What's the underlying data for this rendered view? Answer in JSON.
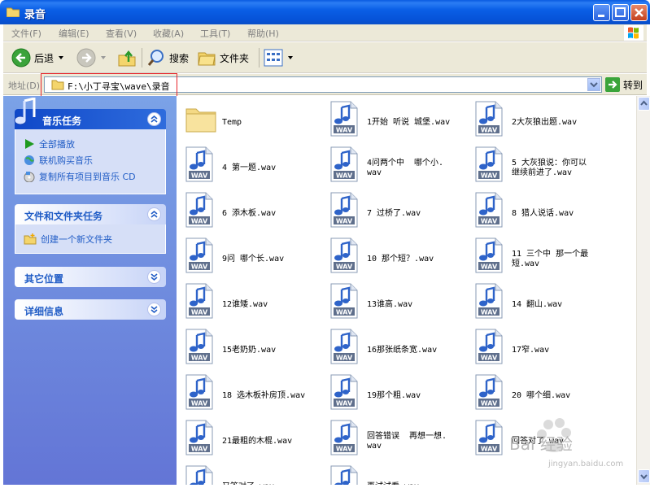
{
  "window": {
    "title": "录音",
    "colors": {
      "titlebar": "#0a5fe6",
      "leftpane": "#6f8cdf",
      "link": "#215dc6",
      "highlight": "#e8262b"
    }
  },
  "menu": [
    "文件(F)",
    "编辑(E)",
    "查看(V)",
    "收藏(A)",
    "工具(T)",
    "帮助(H)"
  ],
  "toolbar": {
    "back_label": "后退",
    "search_label": "搜索",
    "folders_label": "文件夹"
  },
  "address": {
    "label": "地址(D)",
    "value": "F:\\小丁寻宝\\wave\\录音",
    "go_label": "转到"
  },
  "sidebar": {
    "music_tasks": {
      "title": "音乐任务",
      "items": [
        "全部播放",
        "联机购买音乐",
        "复制所有项目到音乐 CD"
      ]
    },
    "file_tasks": {
      "title": "文件和文件夹任务",
      "items": [
        "创建一个新文件夹"
      ]
    },
    "other_places": {
      "title": "其它位置"
    },
    "details": {
      "title": "详细信息"
    }
  },
  "files": [
    {
      "name": "Temp",
      "type": "folder"
    },
    {
      "name": "1开始 听说 城堡.wav",
      "type": "wav"
    },
    {
      "name": "2大灰狼出题.wav",
      "type": "wav"
    },
    {
      "name": "4 第一题.wav",
      "type": "wav"
    },
    {
      "name": "4问两个中  哪个小.\nwav",
      "type": "wav"
    },
    {
      "name": "5 大灰狼说：你可以\n继续前进了.wav",
      "type": "wav"
    },
    {
      "name": "6 添木板.wav",
      "type": "wav"
    },
    {
      "name": "7 过桥了.wav",
      "type": "wav"
    },
    {
      "name": "8 猎人说话.wav",
      "type": "wav"
    },
    {
      "name": "9问 哪个长.wav",
      "type": "wav"
    },
    {
      "name": "10 那个短？.wav",
      "type": "wav"
    },
    {
      "name": "11 三个中 那一个最\n短.wav",
      "type": "wav"
    },
    {
      "name": "12谁矮.wav",
      "type": "wav"
    },
    {
      "name": "13谁高.wav",
      "type": "wav"
    },
    {
      "name": "14 翻山.wav",
      "type": "wav"
    },
    {
      "name": "15老奶奶.wav",
      "type": "wav"
    },
    {
      "name": "16那张纸条宽.wav",
      "type": "wav"
    },
    {
      "name": "17窄.wav",
      "type": "wav"
    },
    {
      "name": "18 选木板补房顶.wav",
      "type": "wav"
    },
    {
      "name": "19那个粗.wav",
      "type": "wav"
    },
    {
      "name": "20 哪个细.wav",
      "type": "wav"
    },
    {
      "name": "21最粗的木棍.wav",
      "type": "wav"
    },
    {
      "name": "回答错误  再想一想.\nwav",
      "type": "wav"
    },
    {
      "name": "回答对了.wav",
      "type": "wav"
    },
    {
      "name": "又答对了.wav",
      "type": "wav"
    },
    {
      "name": "再试试看.wav",
      "type": "wav"
    }
  ],
  "watermark": {
    "text": "Bai 经验",
    "url": "jingyan.baidu.com"
  }
}
